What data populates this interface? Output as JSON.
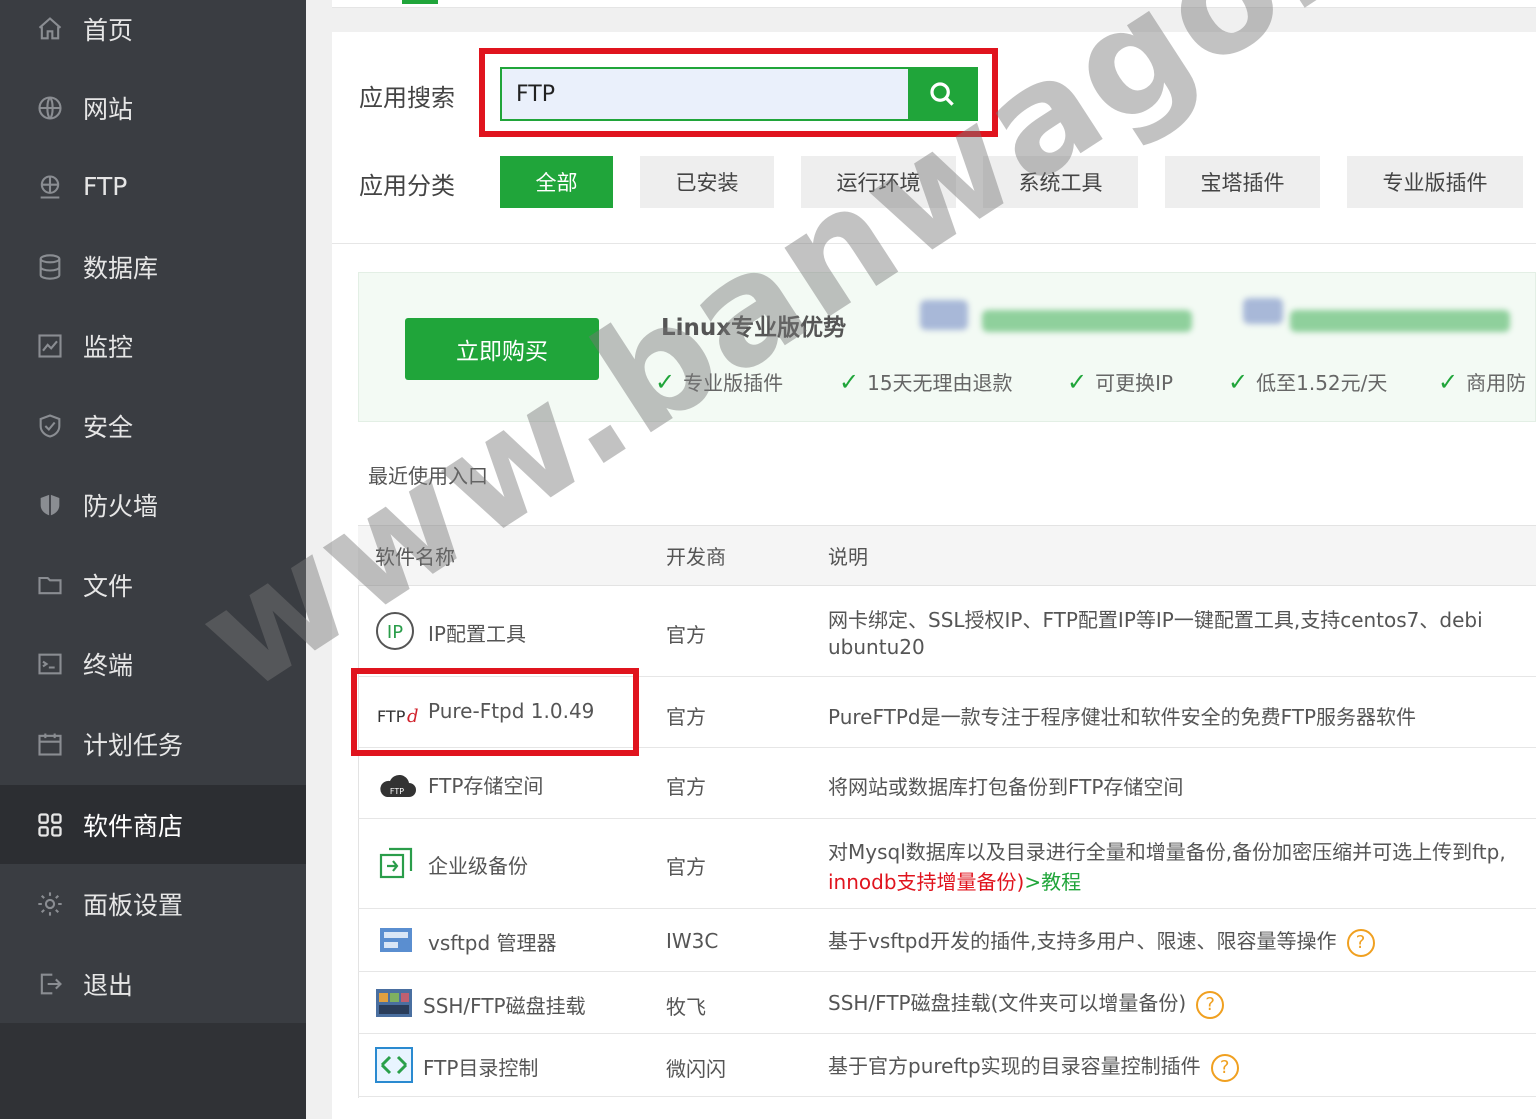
{
  "sidebar": {
    "items": [
      {
        "label": "首页",
        "icon": "home-icon"
      },
      {
        "label": "网站",
        "icon": "globe-icon"
      },
      {
        "label": "FTP",
        "icon": "ftp-icon"
      },
      {
        "label": "数据库",
        "icon": "database-icon"
      },
      {
        "label": "监控",
        "icon": "monitor-icon"
      },
      {
        "label": "安全",
        "icon": "shield-icon"
      },
      {
        "label": "防火墙",
        "icon": "firewall-icon"
      },
      {
        "label": "文件",
        "icon": "folder-icon"
      },
      {
        "label": "终端",
        "icon": "terminal-icon"
      },
      {
        "label": "计划任务",
        "icon": "calendar-icon"
      },
      {
        "label": "软件商店",
        "icon": "apps-icon",
        "active": true
      },
      {
        "label": "面板设置",
        "icon": "gear-icon"
      },
      {
        "label": "退出",
        "icon": "logout-icon"
      }
    ]
  },
  "search": {
    "label": "应用搜索",
    "value": "FTP"
  },
  "categories": {
    "label": "应用分类",
    "items": [
      "全部",
      "已安装",
      "运行环境",
      "系统工具",
      "宝塔插件",
      "专业版插件"
    ],
    "active": "全部"
  },
  "promo": {
    "buy_label": "立即购买",
    "title": "Linux专业版优势",
    "features": [
      "专业版插件",
      "15天无理由退款",
      "可更换IP",
      "低至1.52元/天",
      "商用防"
    ]
  },
  "recent_label": "最近使用入口",
  "table": {
    "headers": [
      "软件名称",
      "开发商",
      "说明"
    ],
    "rows": [
      {
        "name": "IP配置工具",
        "vendor": "官方",
        "desc_line1": "网卡绑定、SSL授权IP、FTP配置IP等IP一键配置工具,支持centos7、debi",
        "desc_line2": "ubuntu20",
        "icon": "ip-icon"
      },
      {
        "name": "Pure-Ftpd 1.0.49",
        "vendor": "官方",
        "desc": "PureFTPd是一款专注于程序健壮和软件安全的免费FTP服务器软件",
        "icon": "ftpd-logo-icon"
      },
      {
        "name": "FTP存储空间",
        "vendor": "官方",
        "desc": "将网站或数据库打包备份到FTP存储空间",
        "icon": "cloud-ftp-icon"
      },
      {
        "name": "企业级备份",
        "vendor": "官方",
        "desc_line1": "对Mysql数据库以及目录进行全量和增量备份,备份加密压缩并可选上传到ftp,",
        "desc_red": "innodb支持增量备份)",
        "desc_link": ">教程",
        "icon": "backup-icon"
      },
      {
        "name": "vsftpd 管理器",
        "vendor": "IW3C",
        "desc": "基于vsftpd开发的插件,支持多用户、限速、限容量等操作",
        "icon": "vsftpd-icon"
      },
      {
        "name": "SSH/FTP磁盘挂载",
        "vendor": "牧飞",
        "desc": "SSH/FTP磁盘挂载(文件夹可以增量备份)",
        "icon": "disk-mount-icon"
      },
      {
        "name": "FTP目录控制",
        "vendor": "微闪闪",
        "desc": "基于官方pureftp实现的目录容量控制插件",
        "icon": "dir-control-icon"
      }
    ]
  },
  "watermark": "www.banwagong.net",
  "colors": {
    "accent": "#20a53a",
    "highlight": "#e0141e",
    "sidebar": "#3a3d42"
  }
}
